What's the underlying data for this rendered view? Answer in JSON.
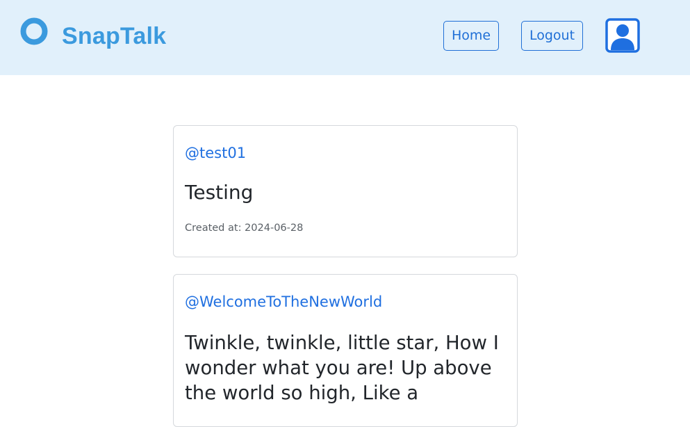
{
  "brand": {
    "name": "SnapTalk",
    "color": "#3b9ade"
  },
  "nav": {
    "home_label": "Home",
    "logout_label": "Logout",
    "avatar_icon": "user-avatar-icon",
    "accent_color": "#1f6fd6"
  },
  "posts": [
    {
      "username": "@test01",
      "title": "Testing",
      "created_at": "Created at: 2024-06-28"
    },
    {
      "username": "@WelcomeToTheNewWorld",
      "title": "Twinkle, twinkle, little star, How I wonder what you are! Up above the world so high, Like a"
    }
  ]
}
